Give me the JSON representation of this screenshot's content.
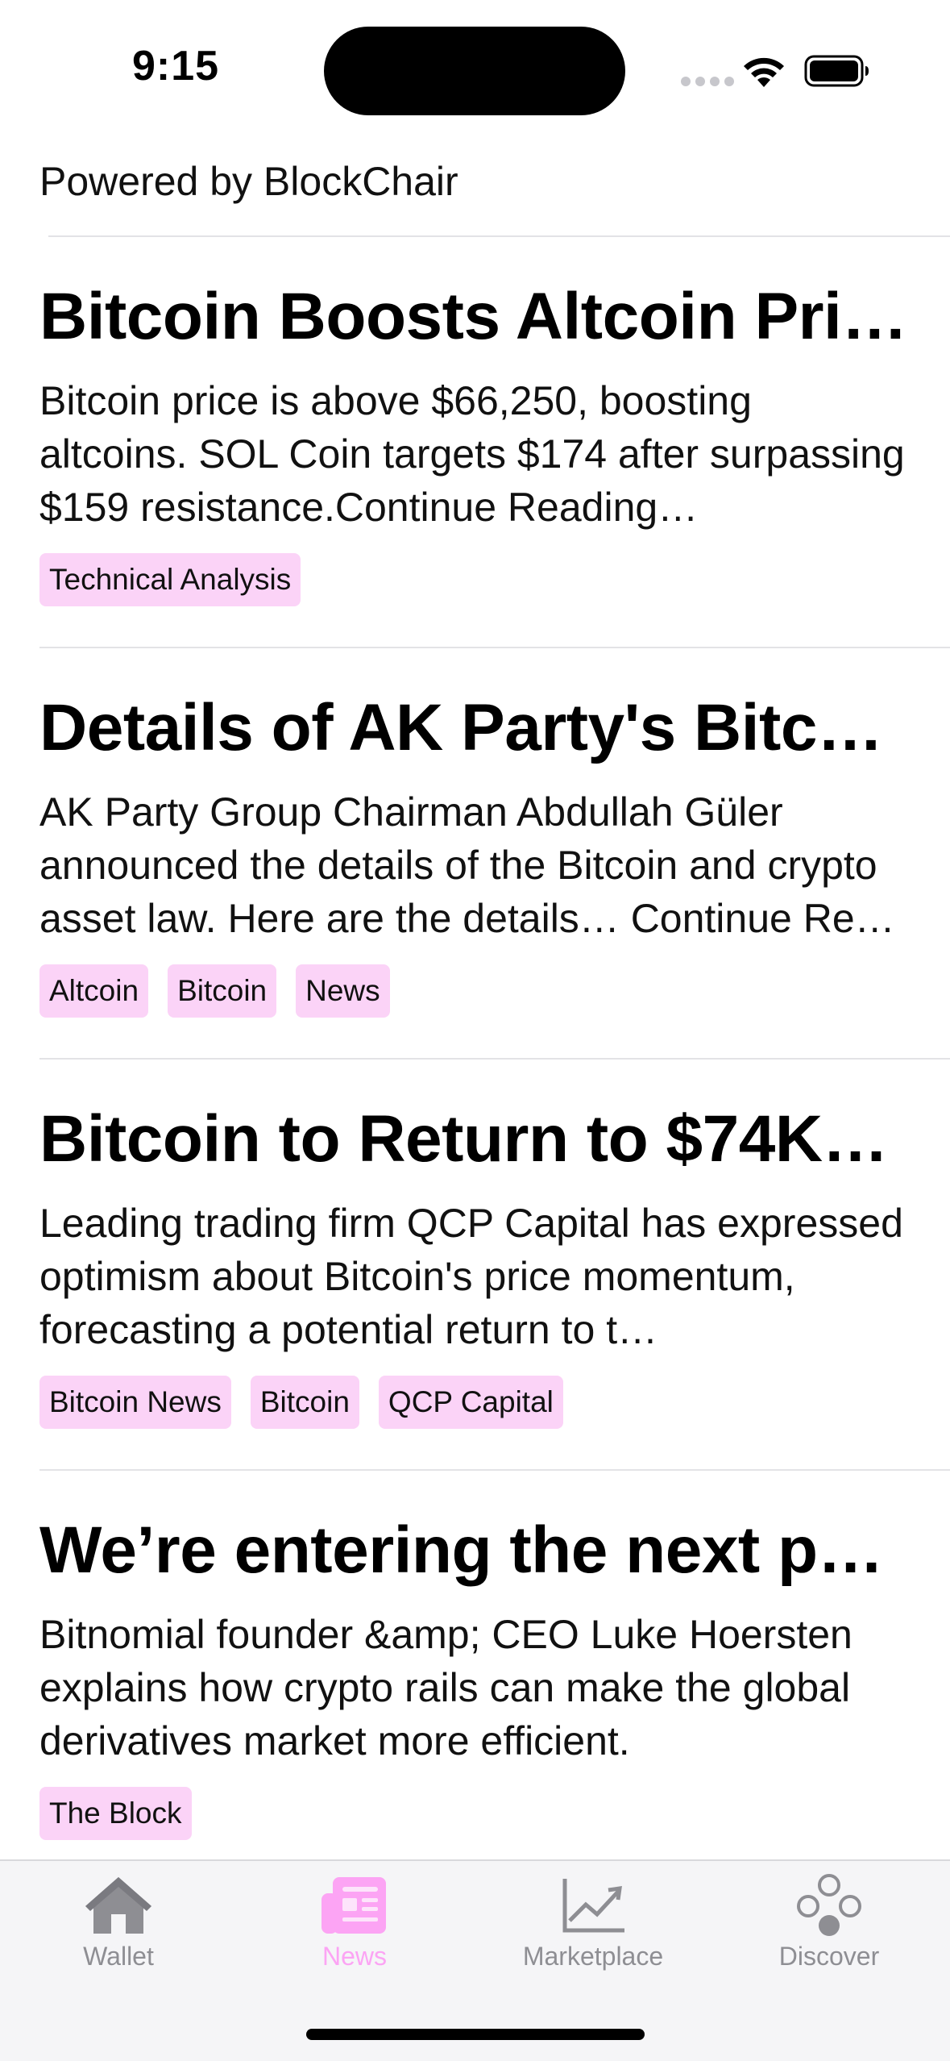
{
  "status_bar": {
    "time": "9:15"
  },
  "header": {
    "powered_by": "Powered by BlockChair"
  },
  "articles": [
    {
      "title": "Bitcoin Boosts Altcoin Pri…",
      "description": "Bitcoin price is above $66,250, boosting altcoins. SOL Coin targets $174 after surpassing $159 resistance.Continue Reading…",
      "tags": [
        "Technical Analysis"
      ]
    },
    {
      "title": "Details of AK Party's Bitco…",
      "description": "AK Party Group Chairman Abdullah Güler announced the details of the Bitcoin and crypto asset law. Here are the details…  Continue Re…",
      "tags": [
        "Altcoin",
        "Bitcoin",
        "News"
      ]
    },
    {
      "title": "Bitcoin to Return to $74K…",
      "description": "Leading trading firm QCP Capital has expressed optimism about Bitcoin's price momentum, forecasting a potential return to t…",
      "tags": [
        "Bitcoin News",
        "Bitcoin",
        "QCP Capital"
      ]
    },
    {
      "title": "We’re entering the next ph…",
      "description": "Bitnomial founder &amp; CEO Luke Hoersten explains how crypto rails can make the global derivatives market more efficient.",
      "tags": [
        "The Block"
      ]
    }
  ],
  "tab_bar": {
    "tabs": [
      {
        "label": "Wallet",
        "icon": "house-icon",
        "active": false
      },
      {
        "label": "News",
        "icon": "newspaper-icon",
        "active": true
      },
      {
        "label": "Marketplace",
        "icon": "chart-line-icon",
        "active": false
      },
      {
        "label": "Discover",
        "icon": "circles-icon",
        "active": false
      }
    ]
  },
  "colors": {
    "accent": "#fca4f4",
    "tag_background": "#fbd3f7",
    "inactive_tab": "#8e8e93"
  }
}
